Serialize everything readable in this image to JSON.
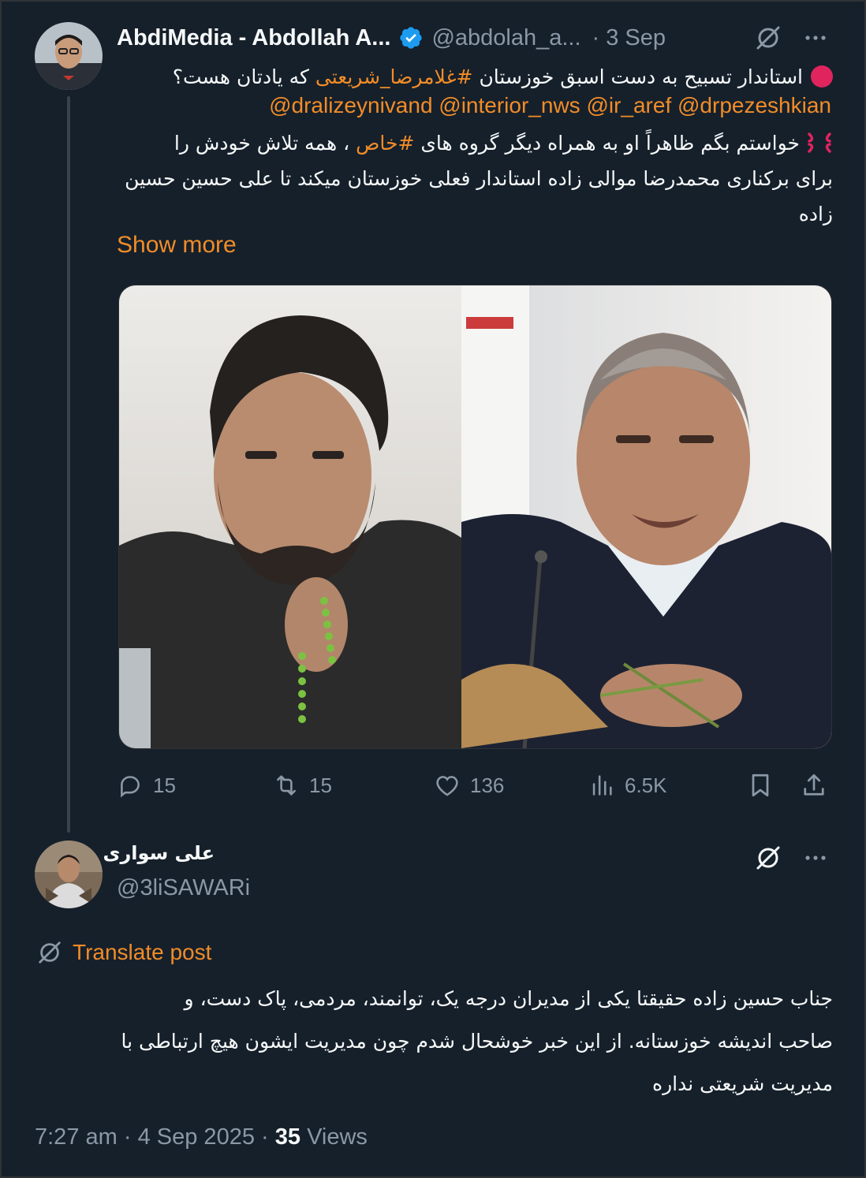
{
  "tweet": {
    "author_name": "AbdiMedia - Abdollah A...",
    "author_handle": "@abdolah_a...",
    "separator": "·",
    "time": "3 Sep",
    "line1_pre": "استاندار تسبیح به دست اسبق خوزستان",
    "line1_hashtag": "#غلامرضا_شریعتی",
    "line1_post": "که یادتان هست؟",
    "mentions": "@dralizeynivand @interior_nws @ir_aref @drpezeshkian",
    "line2_pre": "خواستم بگم ظاهراً او به همراه دیگر گروه های",
    "line2_hashtag": "#خاص",
    "line2_post": "، همه تلاش خودش را",
    "line3": "برای برکناری محمدرضا موالی زاده استاندار فعلی خوزستان میکند تا علی حسین حسین",
    "line4": "زاده",
    "show_more": "Show more",
    "stats": {
      "replies": "15",
      "reposts": "15",
      "likes": "136",
      "views": "6.5K"
    }
  },
  "reply": {
    "author_name": "علی سواری",
    "author_handle": "@3liSAWARi",
    "translate_label": "Translate post",
    "line1": "جناب حسین زاده حقیقتا یکی از مدیران درجه یک، توانمند، مردمی، پاک دست، و",
    "line2": "صاحب اندیشه خوزستانه. از این خبر خوشحال شدم چون  مدیریت ایشون هیچ ارتباطی با",
    "line3": "مدیریت شریعتی نداره",
    "footer_time": "7:27 am",
    "footer_date": "4 Sep 2025",
    "footer_sep": "·",
    "views_count": "35",
    "views_label": "Views"
  },
  "colors": {
    "background": "#15202b",
    "accent": "#f28c28",
    "muted": "#8b98a5",
    "verified": "#1d9bf0",
    "alert_red": "#e0245e"
  }
}
